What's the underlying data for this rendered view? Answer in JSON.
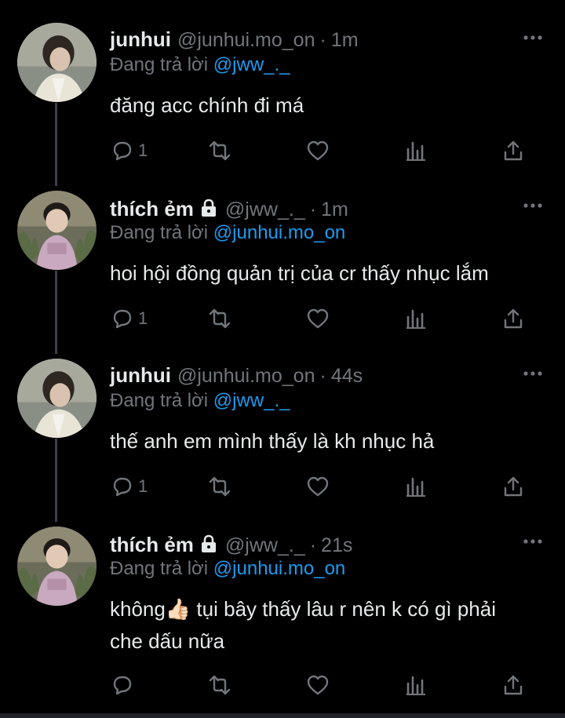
{
  "reply_prefix": "Đang trả lời",
  "tweets": [
    {
      "name": "junhui",
      "locked": false,
      "handle": "@junhui.mo_on",
      "time": "1m",
      "reply_to": "@jww_._",
      "text": "đăng acc chính đi má",
      "reply_count": "1",
      "avatar_icon": "avatar-junhui"
    },
    {
      "name": "thích ẻm",
      "locked": true,
      "handle": "@jww_._",
      "time": "1m",
      "reply_to": "@junhui.mo_on",
      "text": "hoi hội đồng quản trị của cr thấy nhục lắm",
      "reply_count": "1",
      "avatar_icon": "avatar-thich-em"
    },
    {
      "name": "junhui",
      "locked": false,
      "handle": "@junhui.mo_on",
      "time": "44s",
      "reply_to": "@jww_._",
      "text": "thế anh em mình thấy là kh nhục hả",
      "reply_count": "1",
      "avatar_icon": "avatar-junhui"
    },
    {
      "name": "thích ẻm",
      "locked": true,
      "handle": "@jww_._",
      "time": "21s",
      "reply_to": "@junhui.mo_on",
      "text_line1": "không👍🏻 tụi bây thấy lâu r nên k có gì phải",
      "text_line2": "che dấu nữa",
      "reply_count": "",
      "avatar_icon": "avatar-thich-em"
    }
  ],
  "colors": {
    "background": "#000000",
    "text": "#e7e9ea",
    "secondary": "#71767b",
    "mention": "#1d9bf0",
    "thread_line": "#3d4145"
  }
}
